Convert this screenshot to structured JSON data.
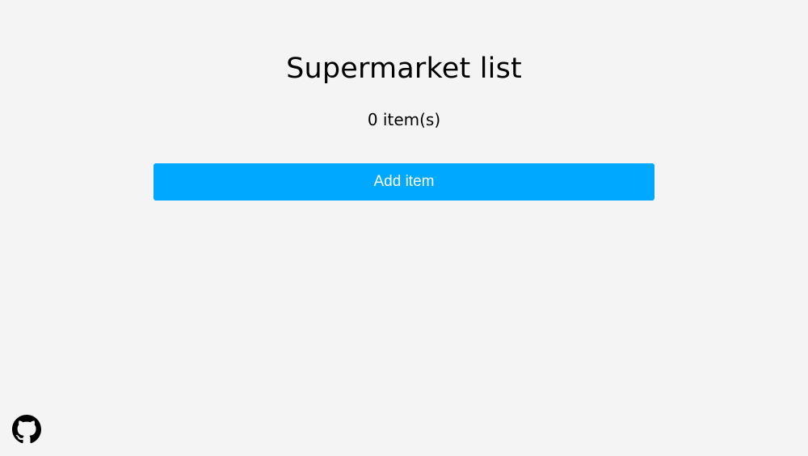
{
  "header": {
    "title": "Supermarket list",
    "item_count": "0 item(s)"
  },
  "actions": {
    "add_item_label": "Add item"
  },
  "footer": {
    "github_icon": "github-icon"
  },
  "colors": {
    "background": "#f4f4f4",
    "accent": "#00a8ff",
    "text": "#000000"
  }
}
